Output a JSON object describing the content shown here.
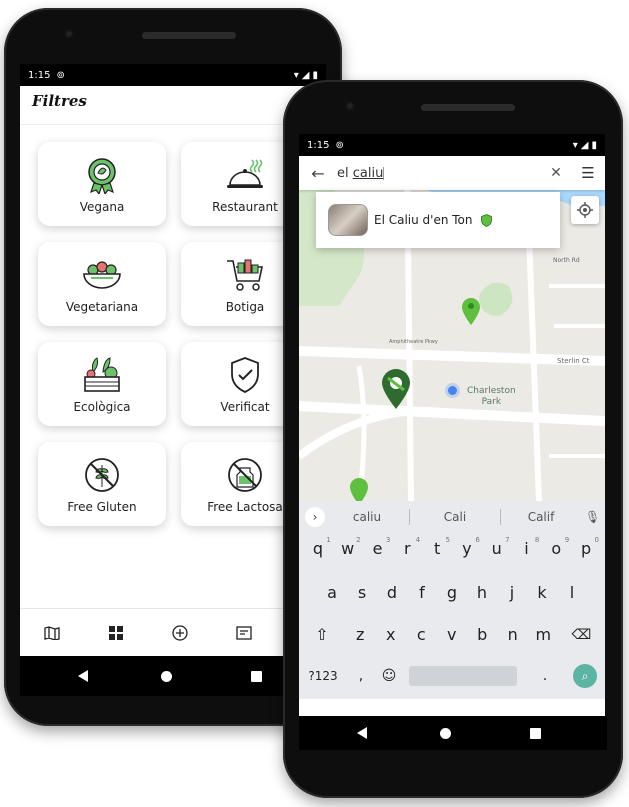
{
  "left_phone": {
    "status": {
      "time": "1:15"
    },
    "title": "Filtres",
    "cards": [
      {
        "label": "Vegana",
        "icon": "vegan-badge-icon"
      },
      {
        "label": "Restaurant",
        "icon": "cloche-icon"
      },
      {
        "label": "Vegetariana",
        "icon": "salad-bowl-icon"
      },
      {
        "label": "Botiga",
        "icon": "shopping-cart-icon"
      },
      {
        "label": "Ecològica",
        "icon": "vegetable-crate-icon"
      },
      {
        "label": "Verificat",
        "icon": "verified-shield-icon"
      },
      {
        "label": "Free Gluten",
        "icon": "no-gluten-icon"
      },
      {
        "label": "Free Lactosa",
        "icon": "no-lactose-icon"
      }
    ],
    "bottom_nav": [
      "map-icon",
      "grid-icon",
      "add-circle-icon",
      "news-icon"
    ]
  },
  "right_phone": {
    "status": {
      "time": "1:15"
    },
    "search": {
      "prefix": "el ",
      "query": "caliu"
    },
    "suggestion": {
      "name": "El Caliu d'en Ton"
    },
    "map": {
      "labels": {
        "park_line1": "Charleston",
        "park_line2": "Park",
        "street_sterlin": "Sterlin Ct",
        "street_north": "North Rd",
        "street_airport": "Amphitheatre Pkwy"
      },
      "colors": {
        "marker_green": "#5fbf3f",
        "marker_dark": "#2f6b2d",
        "blue_dot": "#4285f4"
      }
    },
    "keyboard": {
      "suggestions": [
        "caliu",
        "Cali",
        "Calif"
      ],
      "row1": [
        "q",
        "w",
        "e",
        "r",
        "t",
        "y",
        "u",
        "i",
        "o",
        "p"
      ],
      "row1_nums": [
        "1",
        "2",
        "3",
        "4",
        "5",
        "6",
        "7",
        "8",
        "9",
        "0"
      ],
      "row2": [
        "a",
        "s",
        "d",
        "f",
        "g",
        "h",
        "j",
        "k",
        "l"
      ],
      "row3": [
        "z",
        "x",
        "c",
        "v",
        "b",
        "n",
        "m"
      ],
      "symbols_key": "?123",
      "comma": ",",
      "period": ".",
      "accent": "#5bb5a2"
    }
  }
}
